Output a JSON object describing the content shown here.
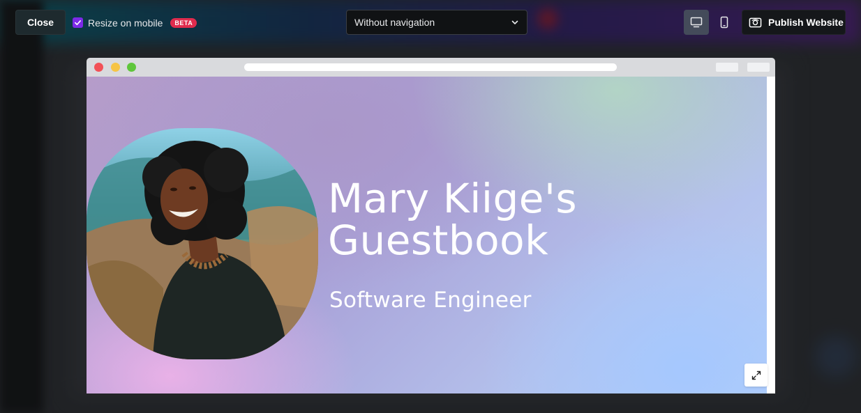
{
  "toolbar": {
    "close_label": "Close",
    "resize_label": "Resize on mobile",
    "resize_checked": true,
    "beta_label": "BETA",
    "navigation_select": {
      "selected": "Without navigation"
    },
    "device_modes": [
      {
        "name": "desktop",
        "icon": "desktop-icon",
        "active": true
      },
      {
        "name": "mobile",
        "icon": "mobile-icon",
        "active": false
      }
    ],
    "publish_label": "Publish Website"
  },
  "preview": {
    "site": {
      "title": "Mary Kiige's Guestbook",
      "subtitle": "Software Engineer",
      "photo": "portrait-photo"
    },
    "expand_icon": "expand-icon"
  },
  "colors": {
    "accent_purple": "#7d2ae8",
    "beta_red": "#e02b4d",
    "toolbar_dark": "#15171a"
  }
}
